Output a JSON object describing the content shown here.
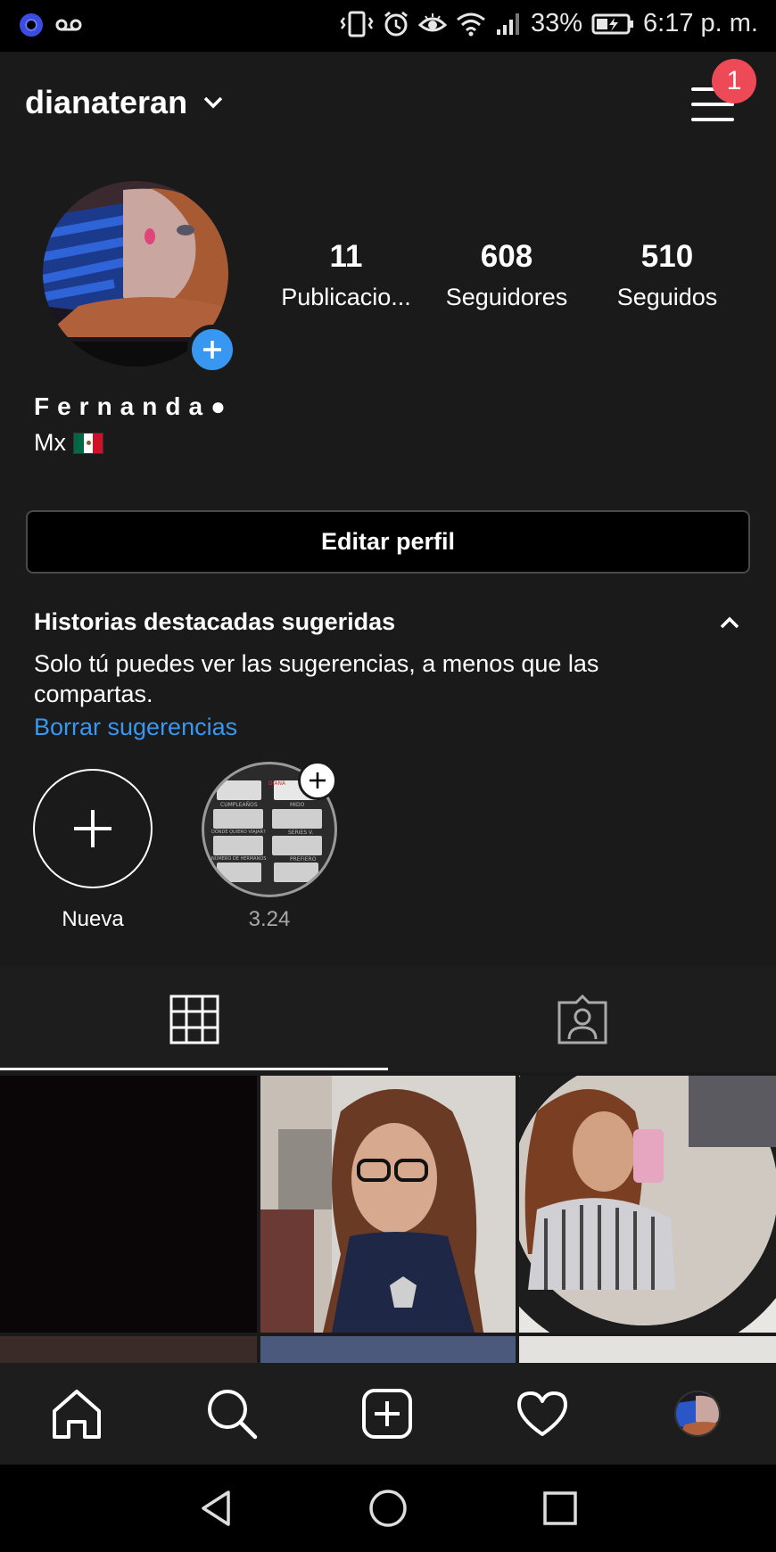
{
  "status_bar": {
    "battery": "33%",
    "time": "6:17 p. m.",
    "icons": [
      "app-ring-icon",
      "voicemail-icon",
      "vibrate-icon",
      "alarm-icon",
      "eye-icon",
      "wifi-icon",
      "signal-icon",
      "battery-icon"
    ]
  },
  "header": {
    "username": "dianateran",
    "notification_count": "1"
  },
  "profile": {
    "display_name": "Fernanda●",
    "bio": "Mx",
    "bio_flag": "mexico-flag",
    "stats": [
      {
        "value": "11",
        "label": "Publicacio..."
      },
      {
        "value": "608",
        "label": "Seguidores"
      },
      {
        "value": "510",
        "label": "Seguidos"
      }
    ],
    "edit_button": "Editar perfil"
  },
  "highlights": {
    "title": "Historias destacadas sugeridas",
    "description": "Solo tú puedes ver las sugerencias, a menos que las compartas.",
    "clear_link": "Borrar sugerencias",
    "items": [
      {
        "label": "Nueva"
      },
      {
        "label": "3.24"
      }
    ],
    "suggested_thumbnail_text": [
      "DIANA",
      "CUMPLEAÑOS",
      "MIDO",
      "DÓNDE QUIERO VIAJAR?",
      "SERIES V.",
      "NÚMERO DE HERMANOS",
      "PREFIERO"
    ]
  },
  "tabs": [
    {
      "name": "grid",
      "icon": "grid-icon",
      "active": true
    },
    {
      "name": "tagged",
      "icon": "tagged-person-icon",
      "active": false
    }
  ],
  "bottom_nav": [
    "home-icon",
    "search-icon",
    "new-post-icon",
    "heart-icon",
    "profile-avatar"
  ],
  "system_nav": [
    "back-icon",
    "home-circle-icon",
    "recents-icon"
  ],
  "colors": {
    "background": "#1a1a1a",
    "accent_blue": "#3897f0",
    "badge_red": "#ed4956"
  }
}
